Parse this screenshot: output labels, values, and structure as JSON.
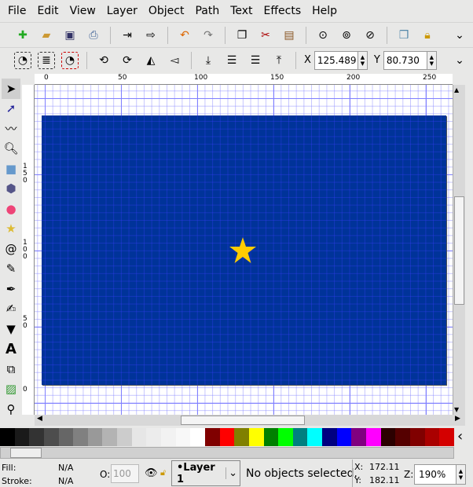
{
  "menu": [
    "File",
    "Edit",
    "View",
    "Layer",
    "Object",
    "Path",
    "Text",
    "Effects",
    "Help"
  ],
  "toolbar": {
    "x_label": "X",
    "x_value": "125.489",
    "y_label": "Y",
    "y_value": "80.730"
  },
  "ruler_top": [
    "0",
    "50",
    "100",
    "150",
    "200",
    "250"
  ],
  "ruler_left": [
    "150",
    "100",
    "50",
    "0"
  ],
  "canvas": {
    "flag_color": "#003399",
    "star_color": "#ffcc00"
  },
  "palette": [
    "#000000",
    "#1a1a1a",
    "#333333",
    "#4d4d4d",
    "#666666",
    "#808080",
    "#999999",
    "#b3b3b3",
    "#cccccc",
    "#e6e6e6",
    "#ececec",
    "#f2f2f2",
    "#f8f8f8",
    "#ffffff",
    "#800000",
    "#ff0000",
    "#808000",
    "#ffff00",
    "#008000",
    "#00ff00",
    "#008080",
    "#00ffff",
    "#000080",
    "#0000ff",
    "#800080",
    "#ff00ff",
    "#2b0000",
    "#550000",
    "#800000",
    "#aa0000",
    "#d40000"
  ],
  "status": {
    "fill_label": "Fill:",
    "fill_value": "N/A",
    "stroke_label": "Stroke:",
    "stroke_value": "N/A",
    "opacity_label": "O:",
    "opacity_value": "100",
    "layer": "•Layer 1",
    "message": "No objects selected.",
    "x_label": "X:",
    "x_value": "172.11",
    "y_label": "Y:",
    "y_value": "182.11",
    "zoom_label": "Z:",
    "zoom_value": "190%"
  }
}
